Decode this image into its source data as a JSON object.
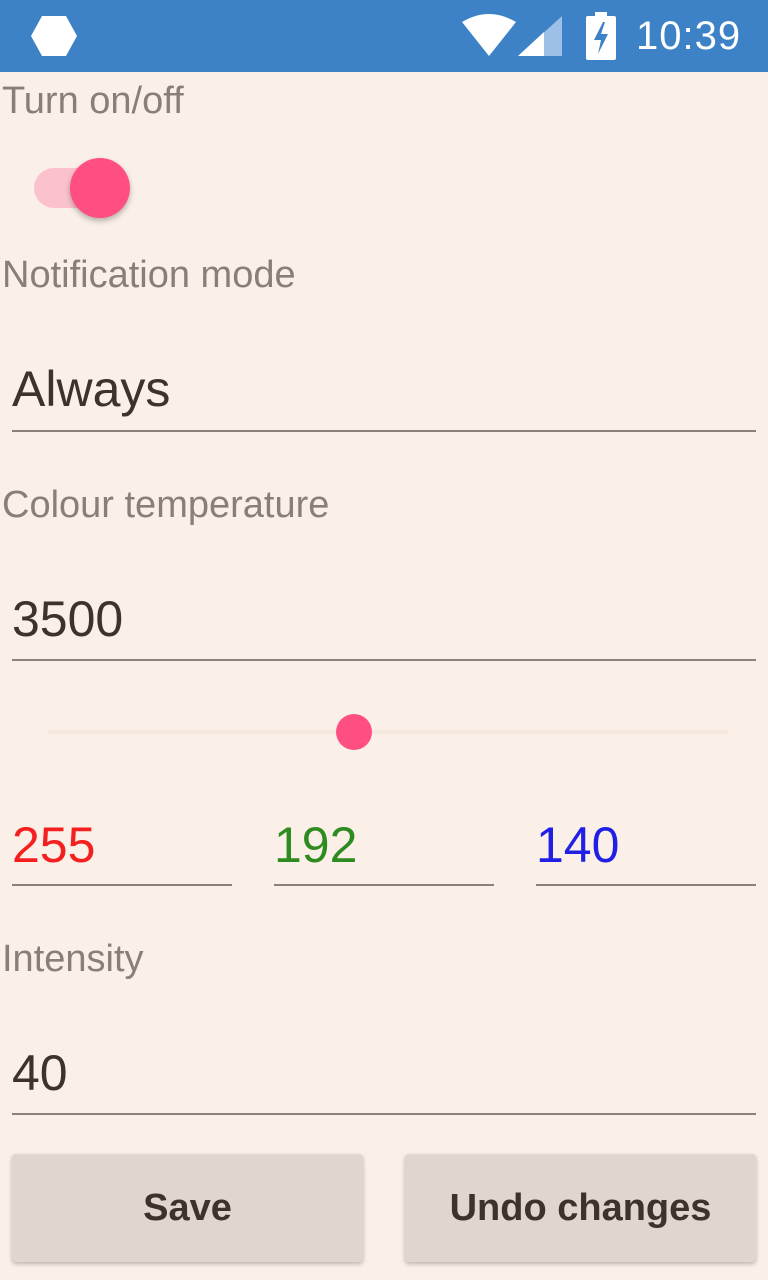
{
  "status_bar": {
    "time": "10:39",
    "icons": [
      "hexagon-icon",
      "wifi-icon",
      "cell-signal-icon",
      "battery-charging-icon"
    ]
  },
  "toggle": {
    "label": "Turn on/off",
    "state": "on",
    "color": "#ff4f82"
  },
  "notification": {
    "label": "Notification mode",
    "value": "Always"
  },
  "colour_temperature": {
    "label": "Colour temperature",
    "value": "3500",
    "slider_fraction": 0.45
  },
  "rgb": {
    "red": "255",
    "green": "192",
    "blue": "140",
    "red_color": "#f41f1f",
    "green_color": "#2e8b1f",
    "blue_color": "#1f1fe6"
  },
  "intensity": {
    "label": "Intensity",
    "value": "40"
  },
  "buttons": {
    "save": "Save",
    "undo": "Undo changes"
  },
  "colors": {
    "status_bar": "#3d82c6",
    "background": "#faf0e8",
    "accent": "#ff4f82"
  }
}
